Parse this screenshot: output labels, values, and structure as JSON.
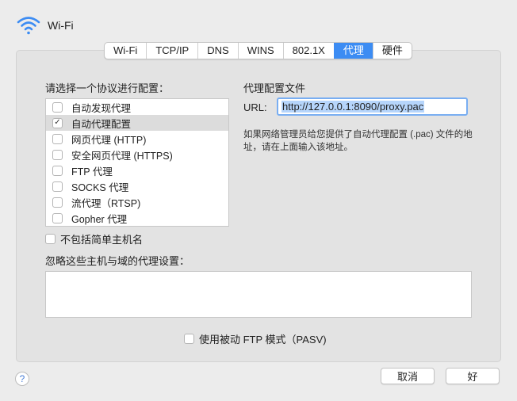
{
  "header": {
    "title": "Wi-Fi",
    "icon": "wifi-icon"
  },
  "tabs": [
    {
      "label": "Wi-Fi",
      "active": false
    },
    {
      "label": "TCP/IP",
      "active": false
    },
    {
      "label": "DNS",
      "active": false
    },
    {
      "label": "WINS",
      "active": false
    },
    {
      "label": "802.1X",
      "active": false
    },
    {
      "label": "代理",
      "active": true
    },
    {
      "label": "硬件",
      "active": false
    }
  ],
  "left": {
    "heading": "请选择一个协议进行配置：",
    "protocols": [
      {
        "label": "自动发现代理",
        "checked": false,
        "selected": false
      },
      {
        "label": "自动代理配置",
        "checked": true,
        "selected": true
      },
      {
        "label": "网页代理 (HTTP)",
        "checked": false,
        "selected": false
      },
      {
        "label": "安全网页代理 (HTTPS)",
        "checked": false,
        "selected": false
      },
      {
        "label": "FTP 代理",
        "checked": false,
        "selected": false
      },
      {
        "label": "SOCKS 代理",
        "checked": false,
        "selected": false
      },
      {
        "label": "流代理（RTSP)",
        "checked": false,
        "selected": false
      },
      {
        "label": "Gopher 代理",
        "checked": false,
        "selected": false
      }
    ]
  },
  "right": {
    "heading": "代理配置文件",
    "url_label": "URL:",
    "url_value": "http://127.0.0.1:8090/proxy.pac",
    "hint": "如果网络管理员给您提供了自动代理配置 (.pac) 文件的地址，请在上面输入该地址。"
  },
  "exclude_simple": {
    "label": "不包括简单主机名",
    "checked": false
  },
  "bypass": {
    "label": "忽略这些主机与域的代理设置：",
    "value": ""
  },
  "pasv": {
    "label": "使用被动 FTP 模式（PASV)",
    "checked": false
  },
  "footer": {
    "help": "?",
    "cancel": "取消",
    "ok": "好"
  },
  "colors": {
    "accent": "#3c8cf3",
    "selection": "#b6d5fb"
  }
}
